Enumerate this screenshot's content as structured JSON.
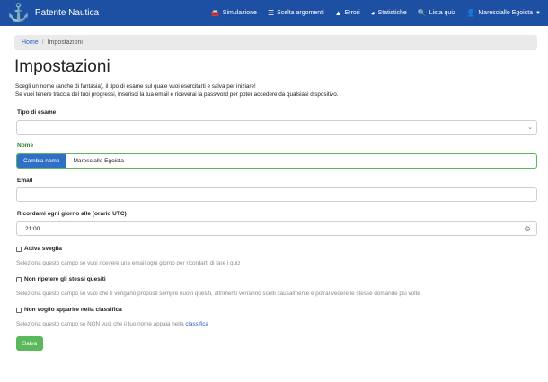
{
  "navbar": {
    "brand": "Patente Nautica",
    "items": [
      {
        "icon": "cars-icon",
        "glyph": "🚘",
        "label": "Simulazione"
      },
      {
        "icon": "list-icon",
        "glyph": "☰",
        "label": "Scelta argomenti"
      },
      {
        "icon": "warning-icon",
        "glyph": "▲",
        "label": "Errori"
      },
      {
        "icon": "chart-pie-icon",
        "glyph": "◕",
        "label": "Statistiche"
      },
      {
        "icon": "search-icon",
        "glyph": "🔍",
        "label": "Lista quiz"
      },
      {
        "icon": "user-icon",
        "glyph": "👤",
        "label": "Maresciallo Egoista"
      }
    ]
  },
  "breadcrumb": {
    "home": "Home",
    "separator": "/",
    "current": "Impostazioni"
  },
  "page": {
    "title": "Impostazioni",
    "intro_line1": "Scegli un nome (anche di fantasia), il tipo di esame sul quale vuoi esercitarti e salva per iniziare!",
    "intro_line2": "Se vuoi tenere traccia dei tuoi progressi, inserisci la tua email e riceverai la password per poter accedere da qualsiasi dispositivo."
  },
  "form": {
    "exam_type": {
      "label": "Tipo di esame",
      "value": ""
    },
    "name": {
      "label": "Nome",
      "button": "Cambia nome",
      "value": "Maresciallo Egoista"
    },
    "email": {
      "label": "Email",
      "value": ""
    },
    "reminder": {
      "label": "Ricordami ogni giorno alle (orario UTC)",
      "value": "21:00"
    },
    "alarm": {
      "label": "Attiva sveglia",
      "checked": false,
      "help": "Seleziona questo campo se vuoi ricevere una email ogni giorno per ricordarti di fare i quiz"
    },
    "no_repeat": {
      "label": "Non ripetere gli stessi quesiti",
      "checked": false,
      "help": "Seleziona questo campo se vuoi che ti vengano proposti sempre nuovi quesiti, altrimenti verranno scelti causalmente e potrai vedere le stesse domande più volte"
    },
    "no_ranking": {
      "label": "Non voglio apparire nella classifica",
      "checked": false,
      "help": "Seleziona questo campo se NON vuoi che il tuo nome appaia nella",
      "help_link": "classifica"
    },
    "save": "Salva"
  },
  "colors": {
    "navbar": "#1d4fa3",
    "primary": "#2f70c6",
    "success": "#5cb85c",
    "label_green": "#2e7d32"
  }
}
